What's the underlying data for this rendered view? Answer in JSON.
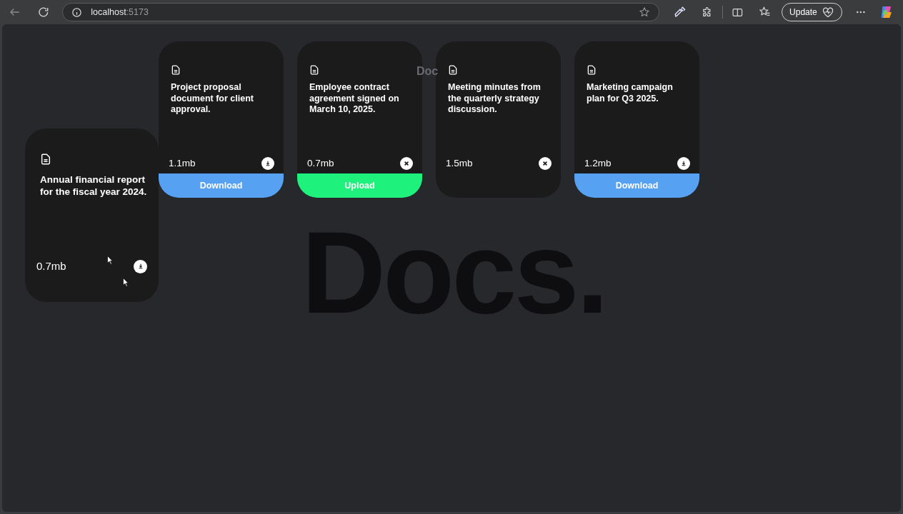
{
  "browser": {
    "address_host": "localhost",
    "address_port": ":5173",
    "update_label": "Update"
  },
  "heading": "Doc",
  "backdrop_title": "Docs.",
  "cards": [
    {
      "description": "Project proposal document for client approval.",
      "size": "1.1mb",
      "action": {
        "kind": "download"
      },
      "footer": {
        "label": "Download",
        "kind": "download"
      }
    },
    {
      "description": "Employee contract agreement signed on March 10, 2025.",
      "size": "0.7mb",
      "action": {
        "kind": "remove"
      },
      "footer": {
        "label": "Upload",
        "kind": "upload"
      }
    },
    {
      "description": "Meeting minutes from the quarterly strategy discussion.",
      "size": "1.5mb",
      "action": {
        "kind": "remove"
      }
    },
    {
      "description": "Marketing campaign plan for Q3 2025.",
      "size": "1.2mb",
      "action": {
        "kind": "download"
      },
      "footer": {
        "label": "Download",
        "kind": "download"
      }
    }
  ],
  "dragged_card": {
    "description": "Annual financial report for the fiscal year 2024.",
    "size": "0.7mb",
    "action": {
      "kind": "download"
    }
  }
}
